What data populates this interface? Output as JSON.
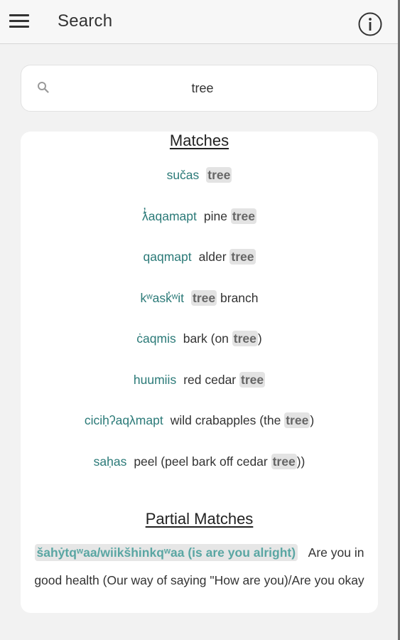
{
  "header": {
    "title": "Search",
    "menu_icon": "hamburger-menu-icon",
    "info_icon": "info-icon"
  },
  "search": {
    "icon": "search-icon",
    "value": "tree"
  },
  "matches": {
    "title": "Matches",
    "items": [
      {
        "word": "sučas",
        "pre": "",
        "hl": "tree",
        "post": ""
      },
      {
        "word": "ƛ̓aqamapt",
        "pre": "pine ",
        "hl": "tree",
        "post": ""
      },
      {
        "word": "qaqmapt",
        "pre": "alder ",
        "hl": "tree",
        "post": ""
      },
      {
        "word": "kʷask̓ʷit",
        "pre": "",
        "hl": "tree",
        "post": " branch"
      },
      {
        "word": "ċaqmis",
        "pre": "bark (on ",
        "hl": "tree",
        "post": ")"
      },
      {
        "word": "huumiis",
        "pre": "red cedar ",
        "hl": "tree",
        "post": ""
      },
      {
        "word": "ciciḥʔaqλmapt",
        "pre": "wild crabapples (the ",
        "hl": "tree",
        "post": ")"
      },
      {
        "word": "saḥas",
        "pre": "peel (peel bark off cedar ",
        "hl": "tree",
        "post": "))"
      }
    ]
  },
  "partial_matches": {
    "title": "Partial Matches",
    "items": [
      {
        "word": "šahẏtqʷaa/wiikšhinkqʷaa (is are you alright)",
        "def_line1": "Are you in",
        "def_line2": "good health (Our way of saying \"How are you)/Are you okay"
      }
    ]
  },
  "colors": {
    "accent_teal": "#2b7a78",
    "highlight_bg": "#e3e3e3",
    "background": "#f2f2f2"
  }
}
